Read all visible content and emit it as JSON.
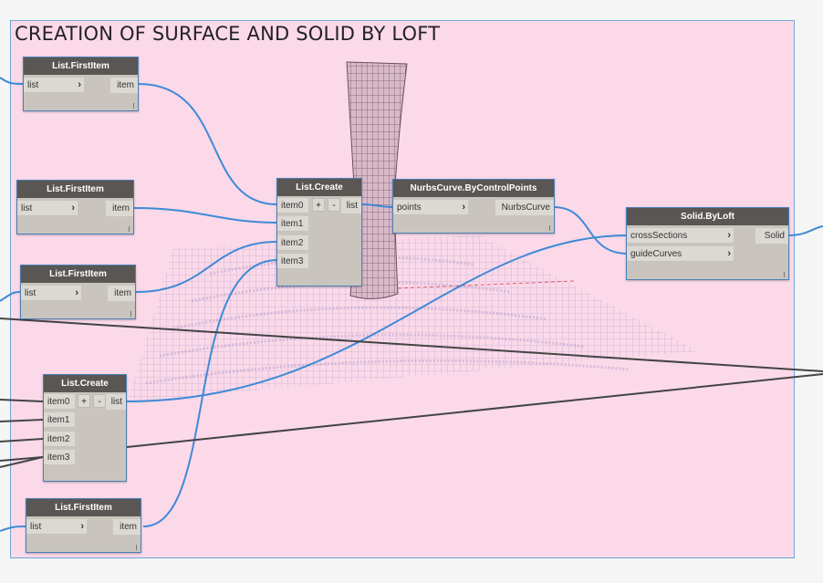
{
  "group": {
    "title": "CREATION OF SURFACE AND SOLID BY LOFT"
  },
  "nodes": {
    "first_item_1": {
      "title": "List.FirstItem",
      "input": "list",
      "output": "item"
    },
    "first_item_2": {
      "title": "List.FirstItem",
      "input": "list",
      "output": "item"
    },
    "first_item_3": {
      "title": "List.FirstItem",
      "input": "list",
      "output": "item"
    },
    "first_item_4": {
      "title": "List.FirstItem",
      "input": "list",
      "output": "item"
    },
    "list_create_top": {
      "title": "List.Create",
      "inputs": [
        "item0",
        "item1",
        "item2",
        "item3"
      ],
      "output": "list",
      "add": "+",
      "remove": "-"
    },
    "list_create_bottom": {
      "title": "List.Create",
      "inputs": [
        "item0",
        "item1",
        "item2",
        "item3"
      ],
      "output": "list",
      "add": "+",
      "remove": "-"
    },
    "nurbs_curve": {
      "title": "NurbsCurve.ByControlPoints",
      "input": "points",
      "output": "NurbsCurve"
    },
    "solid_by_loft": {
      "title": "Solid.ByLoft",
      "inputs": [
        "crossSections",
        "guideCurves"
      ],
      "output": "Solid"
    }
  },
  "colors": {
    "group_fill": "#fbd9e9",
    "group_border": "#6fa6d6",
    "wire_blue": "#3f8ad6",
    "wire_dark": "#444444",
    "node_body": "#c9c5be",
    "node_header": "#595653"
  }
}
